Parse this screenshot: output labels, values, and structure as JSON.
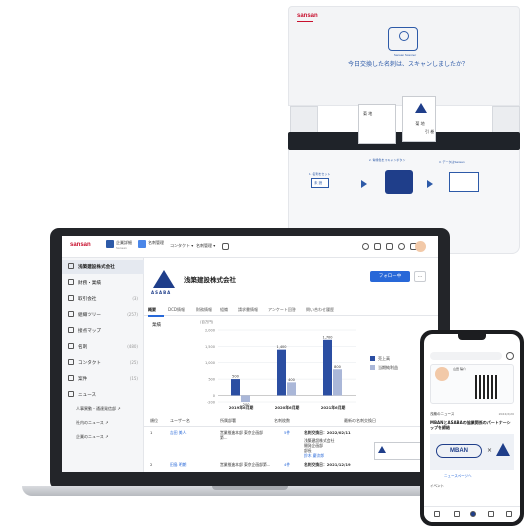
{
  "colors": {
    "brand_red": "#c8102e",
    "accent_blue": "#2868d8",
    "navy": "#1f3e8a",
    "chart_blue": "#2b4ea2",
    "chart_light": "#aab7d8"
  },
  "scanner": {
    "logo": "sansan",
    "mini_label": "Sansan Scanner",
    "question": "今日交換した名刺は、スキャンしましたか？",
    "card_name": "菊 地",
    "card_name2": "引 巻",
    "step1": "1. 名刺をセット",
    "step2": "2. 青緑色をスキャンボタン",
    "step3": "3. データはSansan",
    "step_icon1": "未 読"
  },
  "app": {
    "logo": "sansan",
    "topnav": [
      {
        "label": "企業詳細",
        "sub": "Sansan",
        "icon": "company-icon"
      },
      {
        "label": "名刺管理",
        "sub": "",
        "icon": "card-icon"
      },
      {
        "label": "コンタクト ▾",
        "sub": "",
        "icon": ""
      },
      {
        "label": "名刺管理 ▾",
        "sub": "",
        "icon": ""
      }
    ],
    "sidebar": {
      "company": "浅築建設株式会社",
      "items": [
        {
          "label": "財務・業績",
          "count": ""
        },
        {
          "label": "取引会社",
          "count": "(3)"
        },
        {
          "label": "組織ツリー",
          "count": "(257)"
        },
        {
          "label": "接点マップ",
          "count": ""
        },
        {
          "label": "名刺",
          "count": "(480)"
        },
        {
          "label": "コンタクト",
          "count": "(25)"
        },
        {
          "label": "案件",
          "count": "(15)"
        },
        {
          "label": "ニュース",
          "count": ""
        }
      ],
      "sub_items": [
        "人事異動・通達発信部 ↗",
        "社内のニュース ↗",
        "企業のニュース ↗"
      ]
    },
    "company": {
      "logo_text": "ASABA",
      "name": "浅築建設株式会社",
      "follow": "フォロー中",
      "more": "…"
    },
    "tabs": [
      "概要",
      "DCD情報",
      "財務情報",
      "組織",
      "請求書情報",
      "アンケート回答",
      "問い合わせ履歴"
    ],
    "chart_title": "業績",
    "chart_unit": "(百万円)",
    "table": {
      "headers": [
        "順位",
        "ユーザー名",
        "所属部署",
        "名刺枚数",
        "最新の名刺交換日"
      ],
      "rows": [
        {
          "rank": "1",
          "user": "吉田 美人",
          "dept": "営業推進本部 東京企画部第...",
          "cards": "5件",
          "date": "名刺交換日：2022/02/11",
          "detail1": "浅築建設株式会社",
          "detail2": "開発企画部",
          "detail3": "部長",
          "detail4": "鈴木 慶次郎"
        },
        {
          "rank": "2",
          "user": "田島 明朗",
          "dept": "営業推進本部 東京企画部第...",
          "cards": "4件",
          "date": "名刺交換日：2021/12/19"
        }
      ]
    }
  },
  "phone": {
    "card_name": "山田 陽介",
    "news_title": "浅築のニュース",
    "news_date": "2022/2/20",
    "news_headline": "MBANとASABAの協業関係のパートナーシップを締結",
    "banner_left": "MBAN",
    "banner_x": "×",
    "link": "ニュースページへ",
    "event_title": "イベント"
  },
  "chart_data": {
    "type": "bar",
    "categories": [
      "2019年6月期",
      "2020年6月期",
      "2021年6月期"
    ],
    "series": [
      {
        "name": "売上高",
        "values": [
          500,
          1400,
          1700
        ]
      },
      {
        "name": "当期純利益",
        "values": [
          -200,
          400,
          800
        ]
      }
    ],
    "ylim": [
      -200,
      2000
    ],
    "yticks": [
      2000,
      1500,
      1000,
      500,
      0,
      -200
    ],
    "ytick_labels": [
      "2,000",
      "1,500",
      "1,000",
      "500",
      "0",
      "-200"
    ],
    "value_labels": [
      "500",
      "-200",
      "1,400",
      "400",
      "1,700",
      "800"
    ],
    "legend_position": "right"
  }
}
